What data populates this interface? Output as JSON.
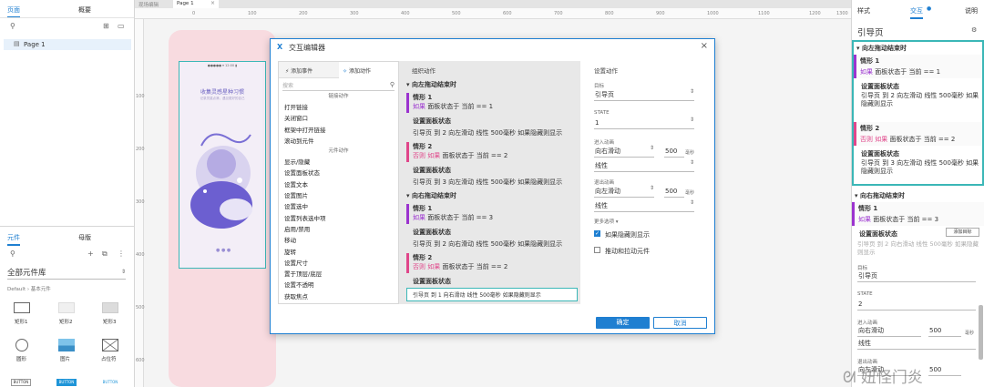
{
  "left_panel": {
    "tabs": [
      "页面",
      "概要"
    ],
    "page_item": "Page 1",
    "lib_tabs": [
      "元件",
      "母版"
    ],
    "lib_name": "全部元件库",
    "lib_sub": "Default › 基本元件",
    "widgets": [
      "矩形1",
      "矩形2",
      "矩形3",
      "圆形",
      "图片",
      "占位符"
    ],
    "buttons": [
      "BUTTON",
      "BUTTON",
      "BUTTON"
    ]
  },
  "canvas": {
    "tabs": [
      "现场编辑",
      "Page 1"
    ],
    "ruler_h": [
      "0",
      "100",
      "200",
      "300",
      "400",
      "500",
      "600",
      "700",
      "800",
      "900",
      "1000",
      "1100",
      "1200",
      "1300",
      "1400"
    ],
    "ruler_v": [
      "100",
      "200",
      "300",
      "400",
      "500",
      "600",
      "700"
    ],
    "phone_title": "收集灵感星种习惯",
    "phone_sub": "记录灵感点滴，遇见更好的自己"
  },
  "dialog": {
    "title": "交互编辑器",
    "tabs": [
      "添加事件",
      "添加动作"
    ],
    "search_placeholder": "搜索",
    "link_header": "链接动作",
    "link_actions": [
      "打开链接",
      "关闭窗口",
      "框架中打开链接",
      "滚动到元件"
    ],
    "widget_header": "元件动作",
    "widget_actions": [
      "显示/隐藏",
      "设置面板状态",
      "设置文本",
      "设置图片",
      "设置选中",
      "设置列表选中项",
      "启用/禁用",
      "移动",
      "旋转",
      "设置尺寸",
      "置于顶层/底层",
      "设置不透明",
      "获取焦点",
      "展开/折叠树节点"
    ],
    "org_title": "组织动作",
    "events": [
      {
        "name": "向左拖动结束时",
        "cases": [
          {
            "name": "情形 1",
            "kw": "如果",
            "cond": "面板状态于 当前 == 1",
            "action": "设置面板状态",
            "detail": "引导页 到 2 向左滑动 线性 500毫秒 如果隐藏则显示"
          },
          {
            "name": "情形 2",
            "kw": "否则 如果",
            "cond": "面板状态于 当前 == 2",
            "action": "设置面板状态",
            "detail": "引导页 到 3 向左滑动 线性 500毫秒 如果隐藏则显示"
          }
        ]
      },
      {
        "name": "向右拖动结束时",
        "cases": [
          {
            "name": "情形 1",
            "kw": "如果",
            "cond": "面板状态于 当前 == 3",
            "action": "设置面板状态",
            "detail": "引导页 到 2 向右滑动 线性 500毫秒 如果隐藏则显示"
          },
          {
            "name": "情形 2",
            "kw": "否则 如果",
            "cond": "面板状态于 当前 == 2",
            "action": "设置面板状态",
            "detail": "引导页 到 1 向右滑动 线性 500毫秒 如果隐藏则显示"
          }
        ]
      }
    ],
    "config": {
      "title": "设置动作",
      "target_label": "目标",
      "target": "引导页",
      "state_label": "STATE",
      "state": "1",
      "in_label": "进入动画",
      "in_anim": "向右滑动",
      "in_ms": "500",
      "in_unit": "毫秒",
      "in_ease": "线性",
      "out_label": "退出动画",
      "out_anim": "向左滑动",
      "out_ms": "500",
      "out_unit": "毫秒",
      "out_ease": "线性",
      "more": "更多选项 ▾",
      "opt1": "如果隐藏则显示",
      "opt2": "推动和拉动元件"
    },
    "ok": "确定",
    "cancel": "取消"
  },
  "right_panel": {
    "tabs": [
      "样式",
      "交互",
      "说明"
    ],
    "title": "引导页",
    "ev1": "向左拖动结束时",
    "ev1_c1_name": "情形 1",
    "ev1_c1_kw": "如果",
    "ev1_c1_cond": "面板状态于 当前 == 1",
    "ev1_c1_action": "设置面板状态",
    "ev1_c1_detail": "引导页 到 2 向左滑动 线性 500毫秒 如果隐藏则显示",
    "ev1_c2_name": "情形 2",
    "ev1_c2_kw": "否则 如果",
    "ev1_c2_cond": "面板状态于 当前 == 2",
    "ev1_c2_action": "设置面板状态",
    "ev1_c2_detail": "引导页 到 3 向左滑动 线性 500毫秒 如果隐藏则显示",
    "ev2": "向右拖动结束时",
    "ev2_c1_name": "情形 1",
    "ev2_c1_kw": "如果",
    "ev2_c1_cond": "面板状态于 当前 == 3",
    "ev2_c1_action": "设置面板状态",
    "add_target": "添加目标",
    "ev2_c1_detail": "引导页 到 2 向右滑动 线性 500毫秒 如果隐藏则显示",
    "target_label": "目标",
    "target": "引导页",
    "state_label": "STATE",
    "state": "2",
    "in_label": "进入动画",
    "in_anim": "向右滑动",
    "in_ms": "500",
    "in_unit": "毫秒",
    "in_ease": "线性",
    "out_label": "退出动画",
    "out_anim": "向左滑动",
    "out_ms": "500"
  },
  "watermark": "妞怪门炎"
}
